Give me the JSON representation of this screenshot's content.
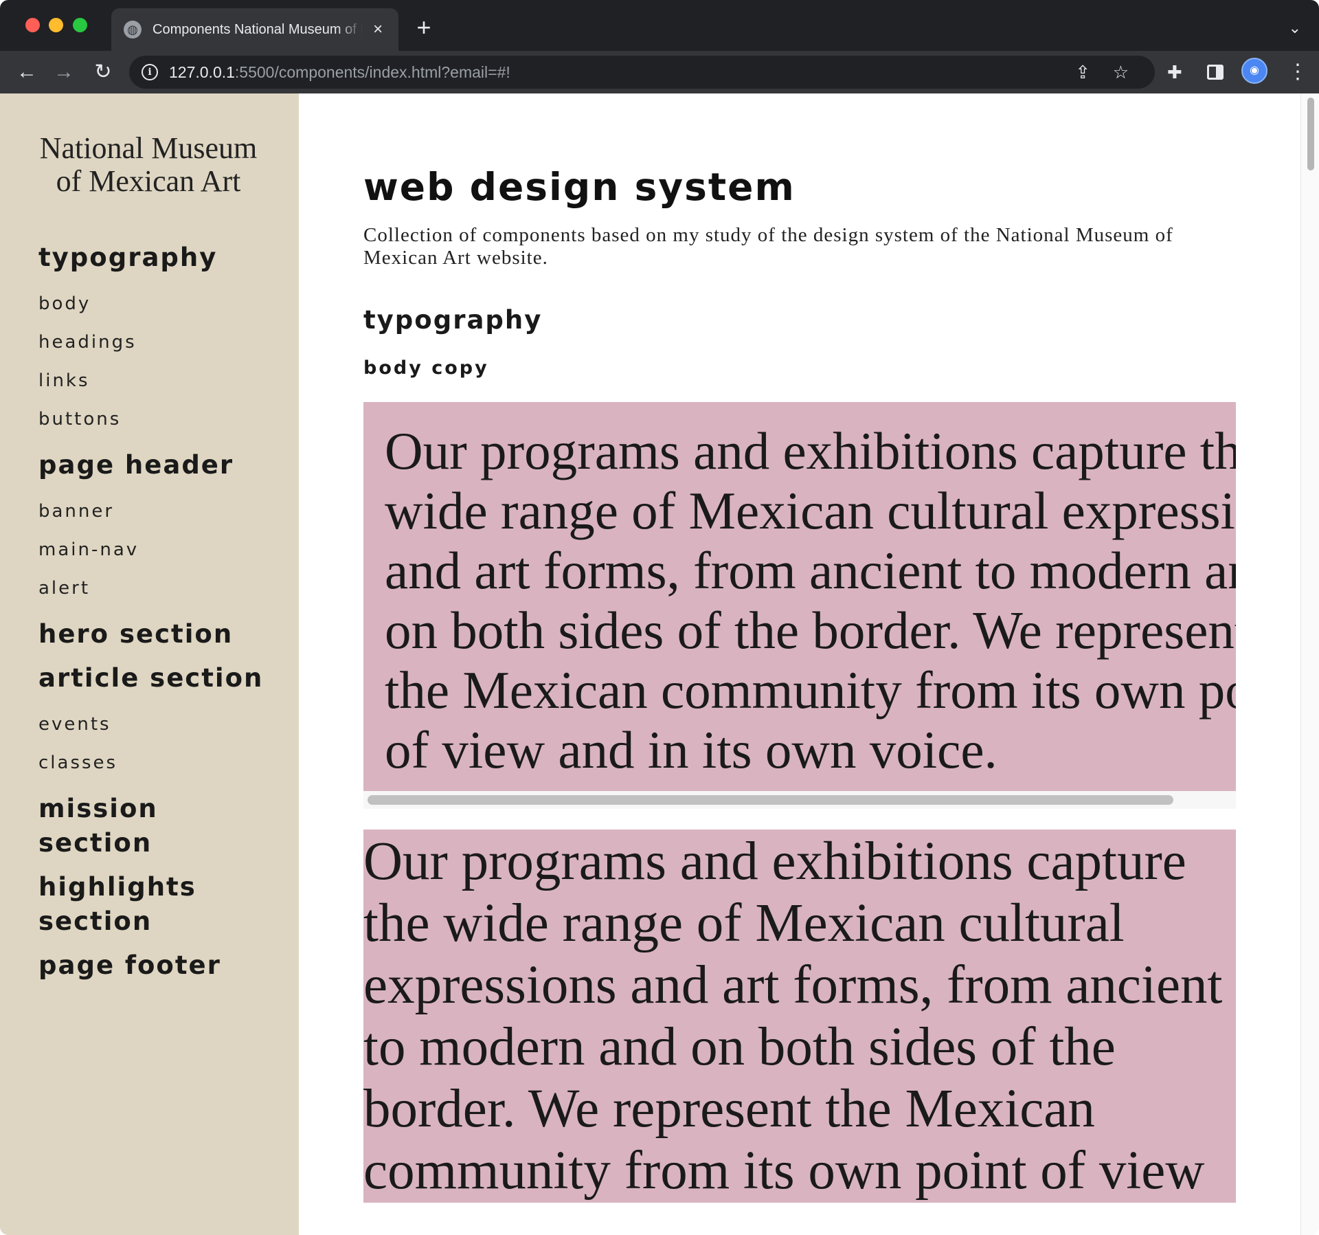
{
  "browser": {
    "tab_title": "Components National Museum of Mexican Art",
    "url_host": "127.0.0.1",
    "url_rest": ":5500/components/index.html?email=#!",
    "new_tab_label": "+",
    "close_label": "×"
  },
  "sidebar": {
    "museum_title": "National Museum of Mexican Art",
    "groups": [
      {
        "heading": "typography",
        "items": [
          "body",
          "headings",
          "links",
          "buttons"
        ]
      },
      {
        "heading": "page header",
        "items": [
          "banner",
          "main-nav",
          "alert"
        ]
      },
      {
        "heading": "hero section",
        "items": []
      },
      {
        "heading": "article section",
        "items": [
          "events",
          "classes"
        ]
      },
      {
        "heading": "mission section",
        "items": []
      },
      {
        "heading": "highlights section",
        "items": []
      },
      {
        "heading": "page footer",
        "items": []
      }
    ]
  },
  "main": {
    "title": "web design system",
    "description": "Collection of components based on my study of the design system of the National Museum of Mexican Art website.",
    "section_title": "typography",
    "sub_title": "body copy",
    "sample_text_1": "Our programs and exhibitions capture the wide range of Mexican cultural expressions and art forms, from ancient to modern and on both sides of the border. We represent the Mexican community from its own point of view and in its own voice.",
    "sample_text_2": "Our programs and exhibitions capture the wide range of Mexican cultural expressions and art forms, from ancient to modern and on both sides of the border. We represent the Mexican community from its own point of view and in its own voice."
  },
  "colors": {
    "sidebar_bg": "#ded6c2",
    "sample_bg": "#d9b3c0",
    "chrome_dark": "#202124",
    "chrome_toolbar": "#35363a"
  },
  "icons": {
    "back": "arrow-left-icon",
    "forward": "arrow-right-icon",
    "reload": "reload-icon",
    "info": "info-icon",
    "share": "share-icon",
    "bookmark": "star-icon",
    "extensions": "puzzle-icon",
    "side_panel": "side-panel-icon",
    "profile": "profile-avatar",
    "menu": "kebab-menu-icon"
  }
}
